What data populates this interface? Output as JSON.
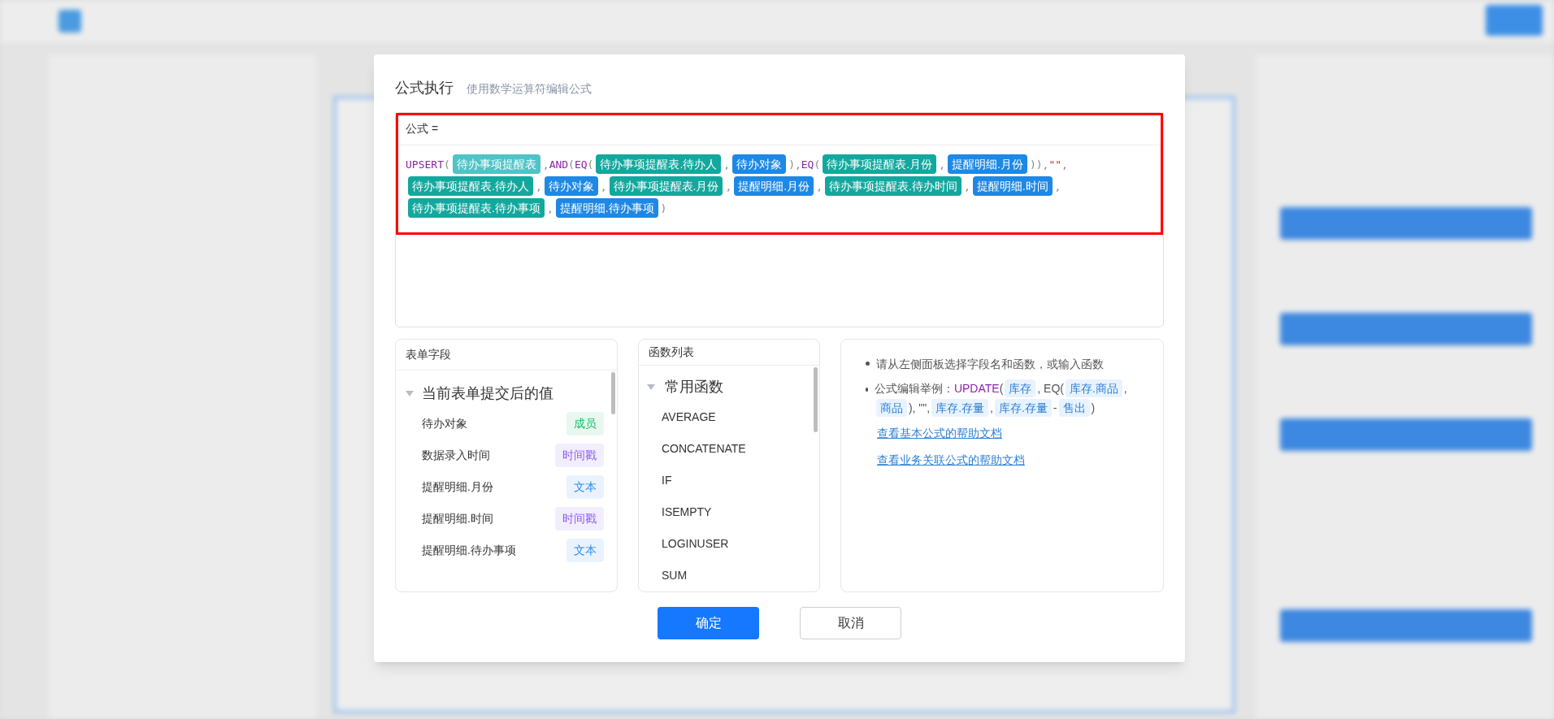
{
  "dialog": {
    "title": "公式执行",
    "subtitle": "使用数学运算符编辑公式",
    "formula": {
      "label": "公式 =",
      "tokens": [
        {
          "kind": "func",
          "text": "UPSERT"
        },
        {
          "kind": "punct",
          "text": "("
        },
        {
          "kind": "table",
          "text": "待办事项提醒表"
        },
        {
          "kind": "punct",
          "text": ","
        },
        {
          "kind": "func",
          "text": "AND"
        },
        {
          "kind": "punct",
          "text": "("
        },
        {
          "kind": "func",
          "text": "EQ"
        },
        {
          "kind": "punct",
          "text": "("
        },
        {
          "kind": "field",
          "text": "待办事项提醒表.待办人"
        },
        {
          "kind": "punct",
          "text": ","
        },
        {
          "kind": "ref",
          "text": "待办对象"
        },
        {
          "kind": "punct",
          "text": "),"
        },
        {
          "kind": "func",
          "text": "EQ"
        },
        {
          "kind": "punct",
          "text": "("
        },
        {
          "kind": "field",
          "text": "待办事项提醒表.月份"
        },
        {
          "kind": "punct",
          "text": ","
        },
        {
          "kind": "ref",
          "text": "提醒明细.月份"
        },
        {
          "kind": "punct",
          "text": ")),"
        },
        {
          "kind": "string",
          "text": "\"\""
        },
        {
          "kind": "punct",
          "text": ","
        },
        {
          "kind": "field",
          "text": "待办事项提醒表.待办人"
        },
        {
          "kind": "punct",
          "text": ","
        },
        {
          "kind": "ref",
          "text": "待办对象"
        },
        {
          "kind": "punct",
          "text": ","
        },
        {
          "kind": "field",
          "text": "待办事项提醒表.月份"
        },
        {
          "kind": "punct",
          "text": ","
        },
        {
          "kind": "ref",
          "text": "提醒明细.月份"
        },
        {
          "kind": "punct",
          "text": ","
        },
        {
          "kind": "field",
          "text": "待办事项提醒表.待办时间"
        },
        {
          "kind": "punct",
          "text": ","
        },
        {
          "kind": "ref",
          "text": "提醒明细.时间"
        },
        {
          "kind": "punct",
          "text": ","
        },
        {
          "kind": "field",
          "text": "待办事项提醒表.待办事项"
        },
        {
          "kind": "punct",
          "text": ","
        },
        {
          "kind": "ref",
          "text": "提醒明细.待办事项"
        },
        {
          "kind": "punct",
          "text": ")"
        }
      ]
    },
    "fields_panel": {
      "title": "表单字段",
      "groups": [
        {
          "label": "当前表单提交后的值",
          "expanded": true,
          "items": [
            {
              "label": "待办对象",
              "type": "成员",
              "color": "#19be6b"
            },
            {
              "label": "数据录入时间",
              "type": "时间戳",
              "color": "#8b5cf6"
            },
            {
              "label": "提醒明细.月份",
              "type": "文本",
              "color": "#2d8cf0"
            },
            {
              "label": "提醒明细.时间",
              "type": "时间戳",
              "color": "#8b5cf6"
            },
            {
              "label": "提醒明细.待办事项",
              "type": "文本",
              "color": "#2d8cf0"
            }
          ]
        }
      ]
    },
    "functions_panel": {
      "title": "函数列表",
      "groups": [
        {
          "label": "常用函数",
          "expanded": true,
          "items": [
            "AVERAGE",
            "CONCATENATE",
            "IF",
            "ISEMPTY",
            "LOGINUSER",
            "SUM"
          ]
        }
      ]
    },
    "help": {
      "tip": "请从左侧面板选择字段名和函数，或输入函数",
      "example_label": "公式编辑举例：",
      "example_tokens": [
        {
          "kind": "func",
          "text": "UPDATE"
        },
        {
          "kind": "punct",
          "text": "("
        },
        {
          "kind": "chip",
          "text": "库存"
        },
        {
          "kind": "punct",
          "text": ", EQ("
        },
        {
          "kind": "chip",
          "text": "库存.商品"
        },
        {
          "kind": "punct",
          "text": ","
        },
        {
          "kind": "chip",
          "text": "商品"
        },
        {
          "kind": "punct",
          "text": "), \"\","
        },
        {
          "kind": "chip",
          "text": "库存.存量"
        },
        {
          "kind": "punct",
          "text": ","
        },
        {
          "kind": "chip",
          "text": "库存.存量"
        },
        {
          "kind": "punct",
          "text": "-"
        },
        {
          "kind": "chip",
          "text": "售出"
        },
        {
          "kind": "punct",
          "text": ")"
        }
      ],
      "links": [
        "查看基本公式的帮助文档",
        "查看业务关联公式的帮助文档"
      ]
    },
    "buttons": [
      {
        "label": "确定",
        "kind": "primary"
      },
      {
        "label": "取消",
        "kind": "default"
      }
    ]
  }
}
